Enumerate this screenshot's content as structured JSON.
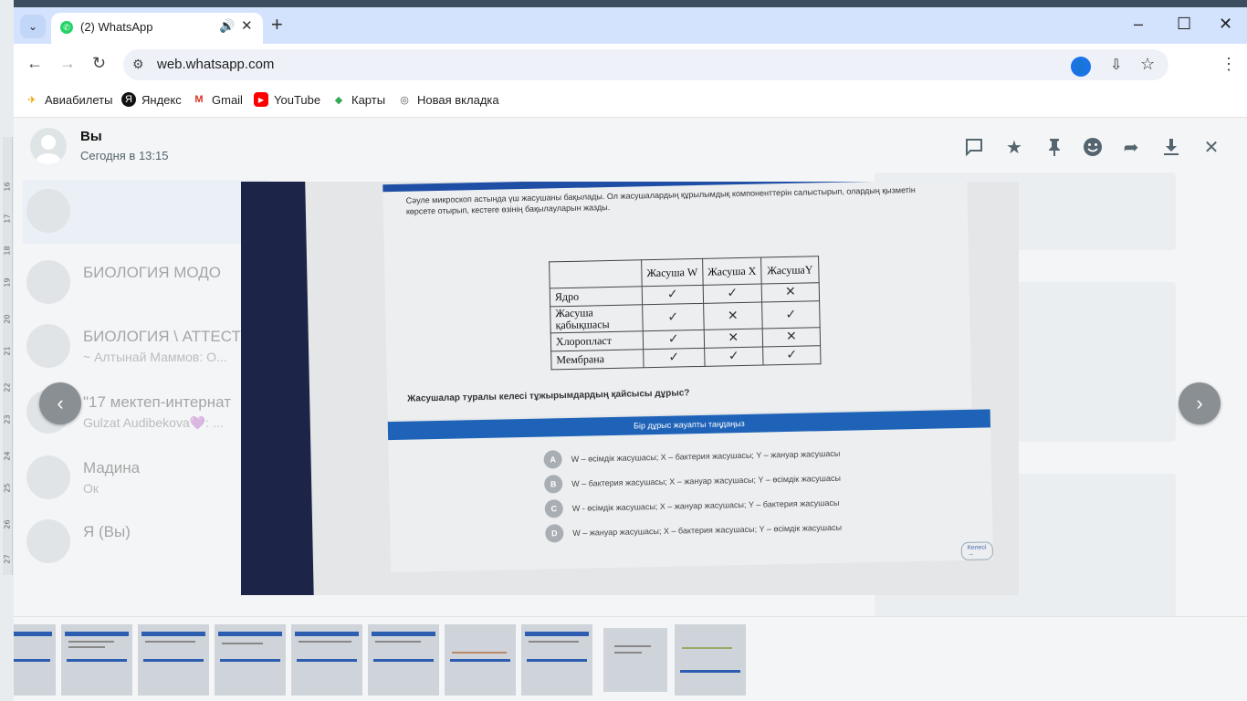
{
  "browser": {
    "tab_title": "(2) WhatsApp",
    "new_tab_symbol": "+",
    "url": "web.whatsapp.com",
    "window_controls": [
      "–",
      "☐",
      "✕"
    ]
  },
  "bookmarks": [
    {
      "label": "Авиабилеты",
      "icon": "plane-icon"
    },
    {
      "label": "Яндекс",
      "icon": "yandex-icon"
    },
    {
      "label": "Gmail",
      "icon": "gmail-icon"
    },
    {
      "label": "YouTube",
      "icon": "youtube-icon"
    },
    {
      "label": "Карты",
      "icon": "maps-icon"
    },
    {
      "label": "Новая вкладка",
      "icon": "chrome-icon"
    }
  ],
  "viewer": {
    "sender_name": "Вы",
    "sender_time": "Сегодня в 13:15",
    "header_icons": [
      "reply-icon",
      "star-icon",
      "pin-icon",
      "emoji-icon",
      "forward-icon",
      "download-icon",
      "close-icon"
    ]
  },
  "background_chats": [
    {
      "name": "",
      "preview": ""
    },
    {
      "name": "БИОЛОГИЯ МОДО",
      "preview": ""
    },
    {
      "name": "БИОЛОГИЯ \\ АТТЕСТ",
      "preview": "~ Алтынай Маммов: О..."
    },
    {
      "name": "\"17 мектеп-интернат",
      "preview": "Gulzat Audibekova💜: ..."
    },
    {
      "name": "Мадина",
      "preview": "Ок"
    },
    {
      "name": "Я (Вы)",
      "preview": ""
    }
  ],
  "photo": {
    "question_intro": "Сәуле микроскоп астында үш жасушаны бақылады. Ол жасушалардың құрылымдық компоненттерін салыстырып, олардың қызметін көрсете отырып, кестеге өзінің бақылауларын жазды.",
    "table": {
      "headers": [
        "",
        "Жасуша W",
        "Жасуша X",
        "ЖасушаY"
      ],
      "rows": [
        {
          "label": "Ядро",
          "cells": [
            "✓",
            "✓",
            "✕"
          ]
        },
        {
          "label": "Жасуша қабықшасы",
          "cells": [
            "✓",
            "✕",
            "✓"
          ]
        },
        {
          "label": "Хлоропласт",
          "cells": [
            "✓",
            "✕",
            "✕"
          ]
        },
        {
          "label": "Мембрана",
          "cells": [
            "✓",
            "✓",
            "✓"
          ]
        }
      ]
    },
    "question": "Жасушалар туралы келесі тұжырымдардың қайсысы дұрыс?",
    "answer_header": "Бір дұрыс жауапты таңдаңыз",
    "options": [
      {
        "letter": "A",
        "text": "W – өсімдік жасушасы; X – бактерия жасушасы; Y – жануар жасушасы"
      },
      {
        "letter": "B",
        "text": "W – бактерия жасушасы; X – жануар жасушасы; Y – өсімдік жасушасы"
      },
      {
        "letter": "C",
        "text": "W - өсімдік жасушасы; X – жануар жасушасы; Y – бактерия жасушасы"
      },
      {
        "letter": "D",
        "text": "W – жануар жасушасы; X – бактерия жасушасы; Y – өсімдік жасушасы"
      }
    ],
    "next_label": "Келесі →"
  },
  "nav": {
    "prev": "‹",
    "next": "›"
  }
}
